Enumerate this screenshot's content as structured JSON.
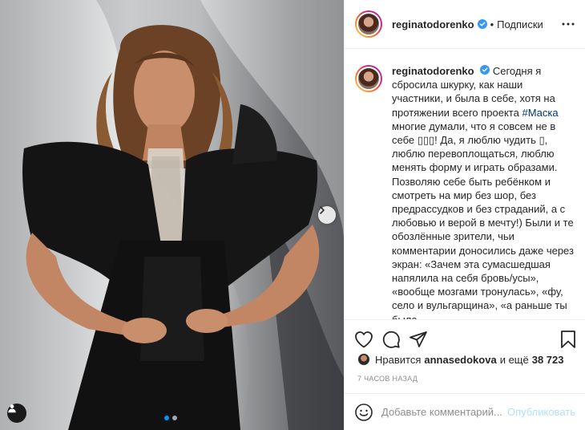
{
  "post": {
    "author": "reginatodorenko",
    "verified": true,
    "follow_separator": "•",
    "follow_label": "Подписки",
    "caption_user": "reginatodorenko",
    "caption_part1": "Сегодня я сбросила шкурку, как наши участники, и была в себе, хотя на протяжении всего проекта",
    "hashtag": "#Маска",
    "caption_part2": "многие думали, что я совсем не в себе ▯▯▯! Да, я люблю чудить ▯, люблю перевоплощаться, люблю менять форму и играть образами. Позволяю себе быть ребёнком и смотреть на мир без шор, без предрассудков и без страданий, а с любовью и верой в мечту!) Были и те обозлённые зрители, чьи комментарии доносились даже через экран: «Зачем эта сумасшедшая напялила на себя бровь/усы», «вообще мозгами тронулась», «фу, село и вульгарщина», «а раньше ты была"
  },
  "likes": {
    "prefix": "Нравится",
    "user": "annasedokova",
    "middle": "и ещё",
    "count": "38 723"
  },
  "timestamp": "7 часов назад",
  "comment": {
    "placeholder": "Добавьте комментарий...",
    "publish_label": "Опубликовать"
  },
  "carousel": {
    "total": 2,
    "current": 1
  },
  "colors": {
    "accent_blue": "#0095f6",
    "publish_disabled": "#b2dffc",
    "hashtag": "#00376b",
    "muted": "#8e8e8e",
    "border": "#efefef"
  },
  "icons": {
    "header_more": "more-horizontal-icon",
    "next": "chevron-right-icon",
    "tags": "user-tag-icon",
    "like": "heart-icon",
    "comment": "comment-bubble-icon",
    "share": "paper-plane-icon",
    "save": "bookmark-icon",
    "emoji": "emoji-icon",
    "verified": "verified-badge-icon"
  }
}
